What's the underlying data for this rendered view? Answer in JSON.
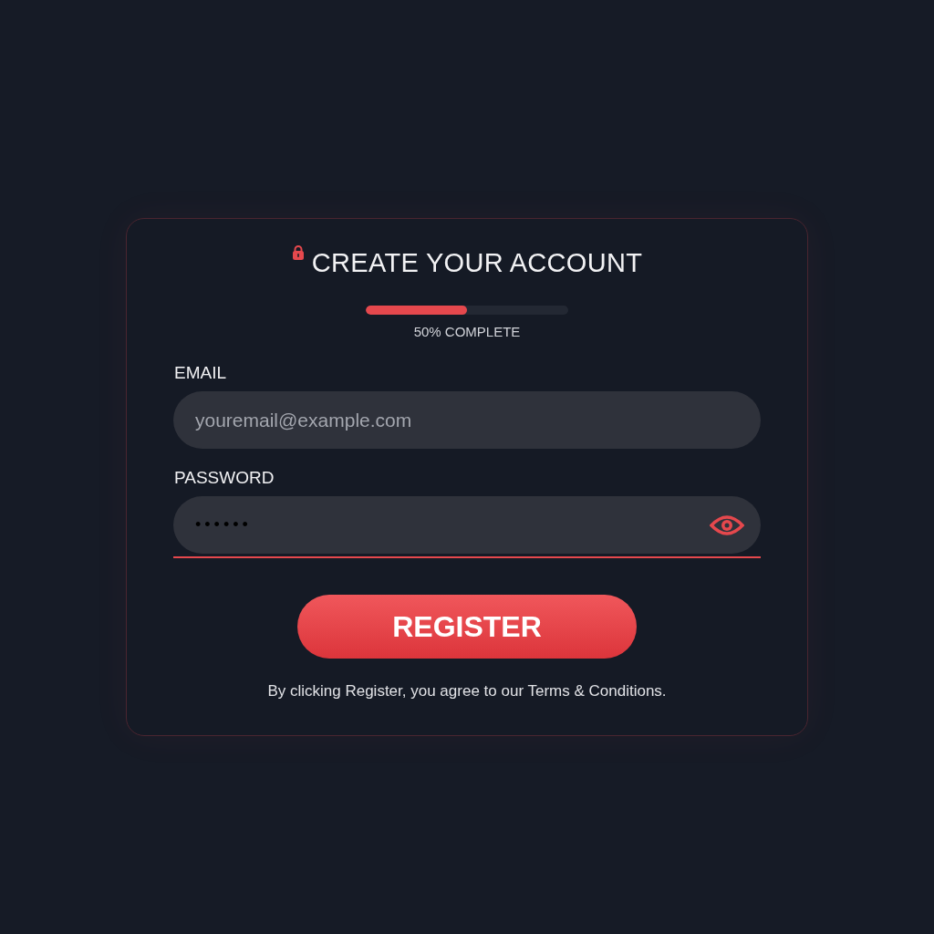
{
  "form": {
    "title": "CREATE YOUR ACCOUNT",
    "progress": {
      "level": 0.5,
      "reading": "50% COMPLETE"
    },
    "fields": [
      {
        "label": "EMAIL",
        "placeholder": "youremail@example.com",
        "kind": "text",
        "focused": false
      },
      {
        "label": "PASSWORD",
        "value": "••••••",
        "kind": "password",
        "focused": true
      }
    ],
    "button": "REGISTER",
    "note": "By clicking Register, you agree to our Terms & Conditions."
  }
}
